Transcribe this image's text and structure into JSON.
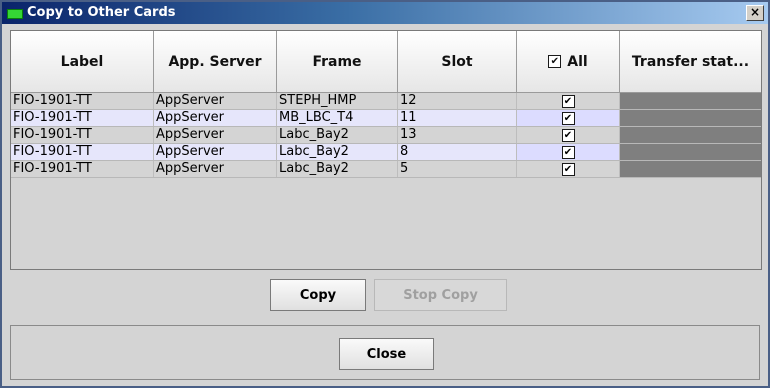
{
  "window": {
    "title": "Copy to Other Cards",
    "close_glyph": "×"
  },
  "table": {
    "columns": [
      "Label",
      "App. Server",
      "Frame",
      "Slot",
      "All",
      "Transfer stat..."
    ],
    "all_checked_glyph": "✔",
    "rows": [
      {
        "label": "FIO-1901-TT",
        "app_server": "AppServer",
        "frame": "STEPH_HMP",
        "slot": "12",
        "checked": "✔"
      },
      {
        "label": "FIO-1901-TT",
        "app_server": "AppServer",
        "frame": "MB_LBC_T4",
        "slot": "11",
        "checked": "✔"
      },
      {
        "label": "FIO-1901-TT",
        "app_server": "AppServer",
        "frame": "Labc_Bay2",
        "slot": "13",
        "checked": "✔"
      },
      {
        "label": "FIO-1901-TT",
        "app_server": "AppServer",
        "frame": "Labc_Bay2",
        "slot": "8",
        "checked": "✔"
      },
      {
        "label": "FIO-1901-TT",
        "app_server": "AppServer",
        "frame": "Labc_Bay2",
        "slot": "5",
        "checked": "✔"
      }
    ]
  },
  "buttons": {
    "copy": "Copy",
    "stop_copy": "Stop Copy",
    "close": "Close"
  },
  "colors": {
    "title_start": "#0a246a",
    "title_end": "#a6caf0",
    "status_fill": "#7f7f7f",
    "alt_row": "#e6e6fb"
  }
}
